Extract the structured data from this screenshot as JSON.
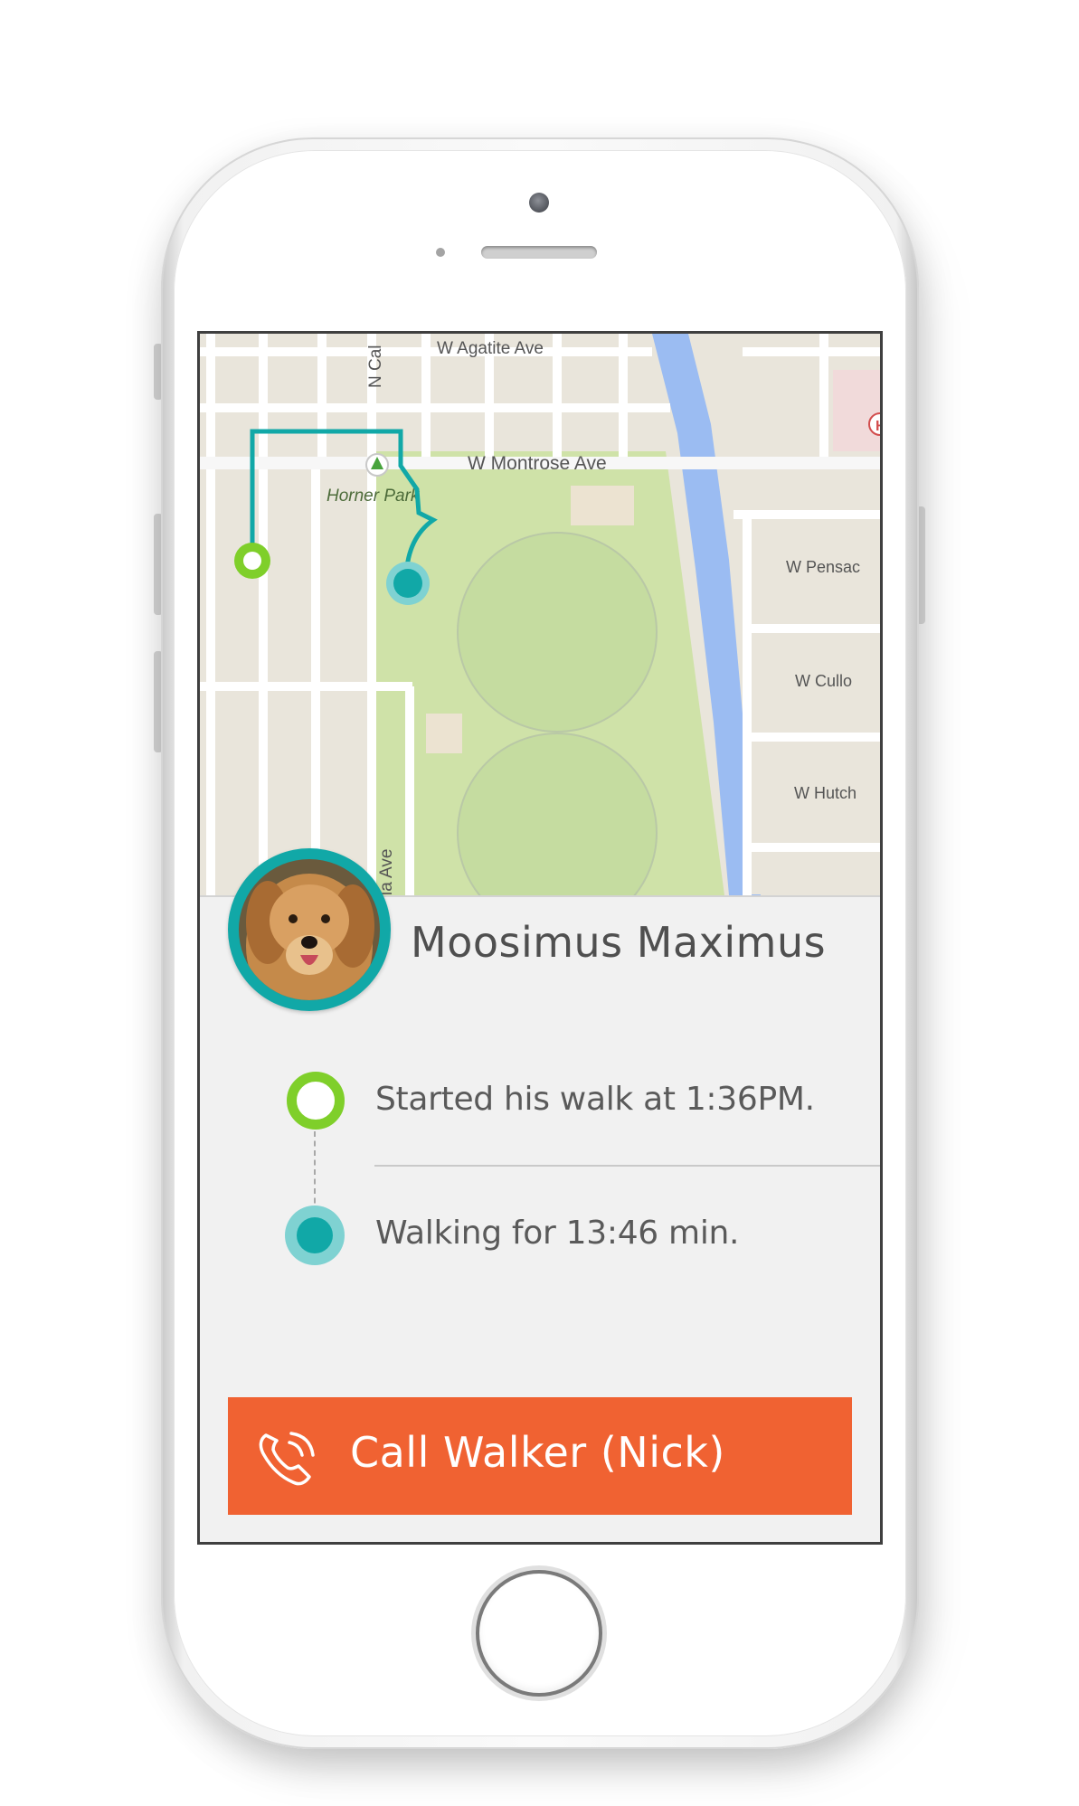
{
  "map": {
    "streets": [
      "W Agatite Ave",
      "N Cal",
      "W Montrose Ave",
      "W Pensac",
      "W Cullo",
      "W Hutch",
      "ia Ave"
    ],
    "park_label": "Horner Park",
    "hospital_marker": "H",
    "route_color": "#11a8a7",
    "start_marker_color": "#7fcf2a",
    "current_marker_color": "#11a8a7"
  },
  "pet": {
    "name": "Moosimus Maximus",
    "avatar_icon": "dog-photo"
  },
  "timeline": {
    "started": "Started his walk at 1:36PM.",
    "walking": "Walking for 13:46 min."
  },
  "call_button": {
    "label": "Call Walker (Nick)",
    "icon": "phone-ringing-icon",
    "color": "#f06232"
  }
}
